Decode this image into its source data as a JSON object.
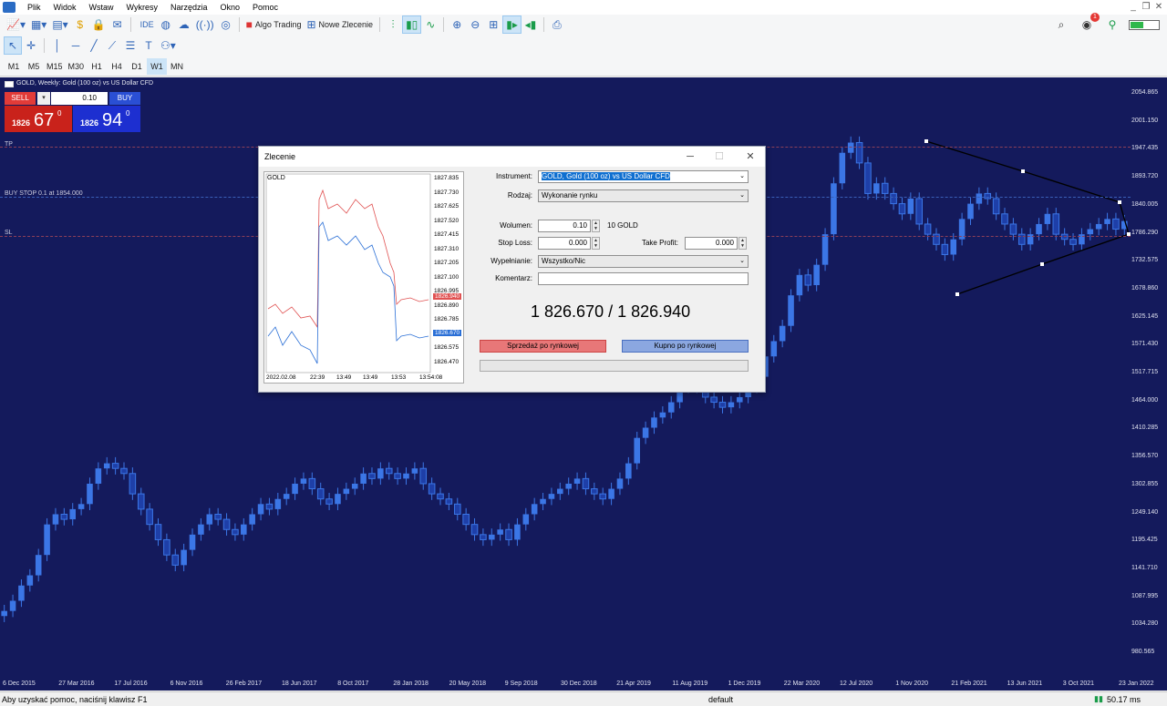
{
  "menu": {
    "items": [
      "Plik",
      "Widok",
      "Wstaw",
      "Wykresy",
      "Narzędzia",
      "Okno",
      "Pomoc"
    ]
  },
  "toolbar": {
    "ide_label": "IDE",
    "algo_label": "Algo Trading",
    "new_order_label": "Nowe Zlecenie",
    "notif_count": "1"
  },
  "timeframes": [
    "M1",
    "M5",
    "M15",
    "M30",
    "H1",
    "H4",
    "D1",
    "W1",
    "MN"
  ],
  "active_timeframe": "W1",
  "chart": {
    "title": "GOLD, Weekly: Gold (100 oz) vs US Dollar CFD",
    "one_click": {
      "sell_label": "SELL",
      "buy_label": "BUY",
      "volume": "0.10",
      "sell_small": "1826",
      "sell_big": "67",
      "sell_sup": "0",
      "buy_small": "1826",
      "buy_big": "94",
      "buy_sup": "0"
    },
    "lines": {
      "tp": "TP",
      "buy_stop": "BUY STOP 0.1 at 1854.000",
      "sl": "SL"
    },
    "colors": {
      "bg": "#141a5c",
      "bull": "#3b76e6",
      "bear": "#ffffff",
      "accent": "#cce4f7"
    }
  },
  "chart_data": {
    "type": "candlestick",
    "ylim": [
      927,
      2108
    ],
    "y_ticks": [
      "2054.865",
      "2001.150",
      "1947.435",
      "1893.720",
      "1840.005",
      "1786.290",
      "1732.575",
      "1678.860",
      "1625.145",
      "1571.430",
      "1517.715",
      "1464.000",
      "1410.285",
      "1356.570",
      "1302.855",
      "1249.140",
      "1195.425",
      "1141.710",
      "1087.995",
      "1034.280",
      "980.565"
    ],
    "x_ticks": [
      "6 Dec 2015",
      "27 Mar 2016",
      "17 Jul 2016",
      "6 Nov 2016",
      "26 Feb 2017",
      "18 Jun 2017",
      "8 Oct 2017",
      "28 Jan 2018",
      "20 May 2018",
      "9 Sep 2018",
      "30 Dec 2018",
      "21 Apr 2019",
      "11 Aug 2019",
      "1 Dec 2019",
      "22 Mar 2020",
      "12 Jul 2020",
      "1 Nov 2020",
      "21 Feb 2021",
      "13 Jun 2021",
      "3 Oct 2021",
      "23 Jan 2022"
    ],
    "close": [
      1060,
      1080,
      1110,
      1130,
      1170,
      1230,
      1250,
      1240,
      1260,
      1270,
      1310,
      1340,
      1350,
      1340,
      1330,
      1290,
      1260,
      1230,
      1200,
      1170,
      1150,
      1180,
      1210,
      1230,
      1250,
      1240,
      1220,
      1210,
      1230,
      1250,
      1270,
      1260,
      1280,
      1290,
      1310,
      1320,
      1300,
      1280,
      1270,
      1290,
      1300,
      1310,
      1330,
      1320,
      1340,
      1330,
      1320,
      1330,
      1340,
      1310,
      1290,
      1280,
      1270,
      1250,
      1230,
      1210,
      1200,
      1210,
      1220,
      1200,
      1230,
      1250,
      1270,
      1280,
      1290,
      1300,
      1310,
      1320,
      1300,
      1290,
      1280,
      1300,
      1320,
      1350,
      1400,
      1420,
      1440,
      1450,
      1470,
      1500,
      1510,
      1500,
      1480,
      1470,
      1460,
      1470,
      1480,
      1500,
      1520,
      1560,
      1590,
      1620,
      1680,
      1720,
      1700,
      1740,
      1800,
      1900,
      1960,
      1980,
      1940,
      1880,
      1900,
      1880,
      1860,
      1840,
      1870,
      1820,
      1800,
      1780,
      1760,
      1790,
      1830,
      1860,
      1880,
      1870,
      1840,
      1820,
      1800,
      1780,
      1800,
      1820,
      1840,
      1800,
      1790,
      1780,
      1800,
      1810,
      1820,
      1830,
      1810,
      1826
    ]
  },
  "dialog": {
    "title": "Zlecenie",
    "labels": {
      "instrument": "Instrument:",
      "rodzaj": "Rodzaj:",
      "wolumen": "Wolumen:",
      "stop_loss": "Stop Loss:",
      "take_profit": "Take Profit:",
      "wypelnianie": "Wypełnianie:",
      "komentarz": "Komentarz:"
    },
    "values": {
      "instrument": "GOLD, Gold (100 oz) vs US Dollar CFD",
      "rodzaj": "Wykonanie rynku",
      "wolumen": "0.10",
      "wolumen_unit": "10 GOLD",
      "stop_loss": "0.000",
      "take_profit": "0.000",
      "wypelnianie": "Wszystko/Nic",
      "komentarz": ""
    },
    "price_display": "1 826.670 / 1 826.940",
    "sell_button": "Sprzedaż po rynkowej",
    "buy_button": "Kupno po rynkowej",
    "mini_chart": {
      "symbol": "GOLD",
      "y_ticks": [
        "1827.835",
        "1827.730",
        "1827.625",
        "1827.520",
        "1827.415",
        "1827.310",
        "1827.205",
        "1827.100",
        "1826.995",
        "1826.890",
        "1826.785",
        "1826.680",
        "1826.575",
        "1826.470"
      ],
      "bid_tag": "1826.670",
      "ask_tag": "1826.940",
      "x_ticks": [
        "2022.02.08",
        "22:39",
        "13:49",
        "13:49",
        "13:53",
        "13:54:08"
      ]
    }
  },
  "status": {
    "help": "Aby uzyskać pomoc, naciśnij klawisz F1",
    "profile": "default",
    "ping": "50.17 ms"
  }
}
